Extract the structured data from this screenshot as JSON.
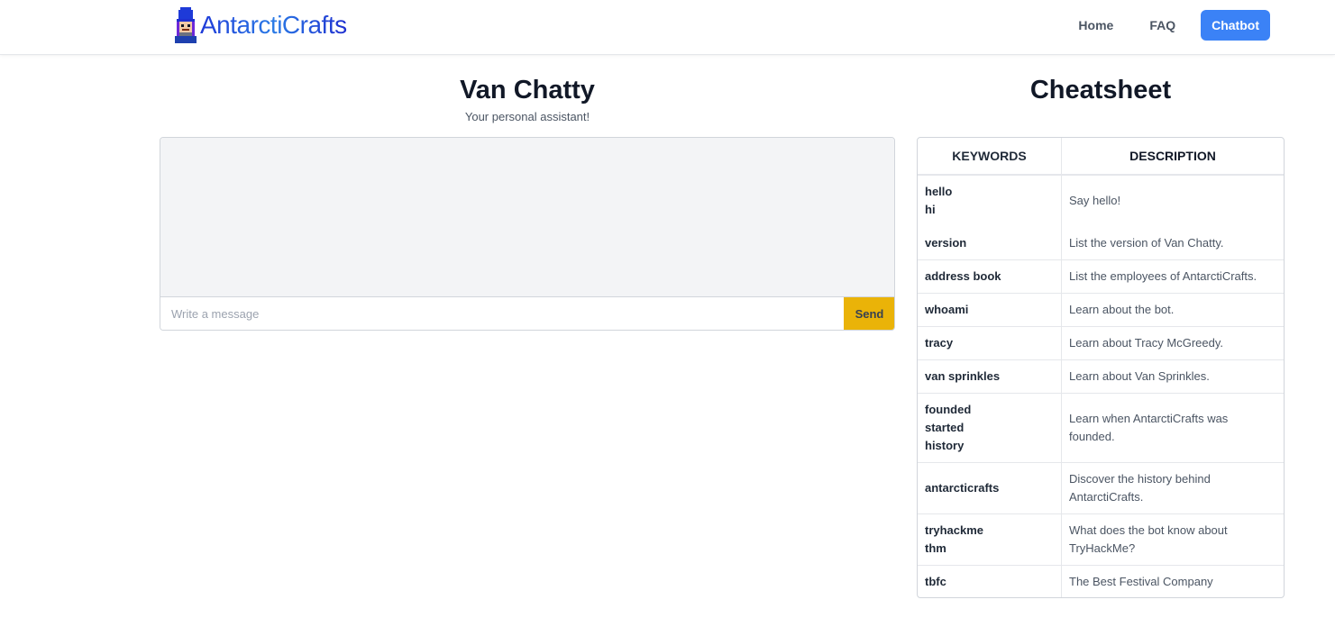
{
  "brand": {
    "name": "AntarctiCrafts"
  },
  "nav": {
    "items": [
      {
        "label": "Home"
      },
      {
        "label": "FAQ"
      },
      {
        "label": "Chatbot",
        "active": true
      }
    ]
  },
  "chat": {
    "title": "Van Chatty",
    "subtitle": "Your personal assistant!",
    "input_placeholder": "Write a message",
    "input_value": "",
    "send_label": "Send"
  },
  "cheatsheet": {
    "title": "Cheatsheet",
    "headers": {
      "keywords": "KEYWORDS",
      "description": "DESCRIPTION"
    },
    "rows": [
      {
        "keywords": [
          "hello",
          "hi"
        ],
        "description": "Say hello!"
      },
      {
        "keywords": [
          "version"
        ],
        "description": "List the version of Van Chatty."
      },
      {
        "keywords": [
          "address book"
        ],
        "description": "List the employees of AntarctiCrafts."
      },
      {
        "keywords": [
          "whoami"
        ],
        "description": "Learn about the bot."
      },
      {
        "keywords": [
          "tracy"
        ],
        "description": "Learn about Tracy McGreedy."
      },
      {
        "keywords": [
          "van sprinkles"
        ],
        "description": "Learn about Van Sprinkles."
      },
      {
        "keywords": [
          "founded",
          "started",
          "history"
        ],
        "description": "Learn when AntarctiCrafts was founded."
      },
      {
        "keywords": [
          "antarcticrafts"
        ],
        "description": "Discover the history behind AntarctiCrafts."
      },
      {
        "keywords": [
          "tryhackme",
          "thm"
        ],
        "description": "What does the bot know about TryHackMe?"
      },
      {
        "keywords": [
          "tbfc"
        ],
        "description": "The Best Festival Company"
      }
    ]
  },
  "colors": {
    "accent": "#3b82f6",
    "send": "#eab308",
    "chat_bg": "#f3f4f6"
  },
  "icons": {
    "logo": "nutcracker-logo-icon"
  }
}
